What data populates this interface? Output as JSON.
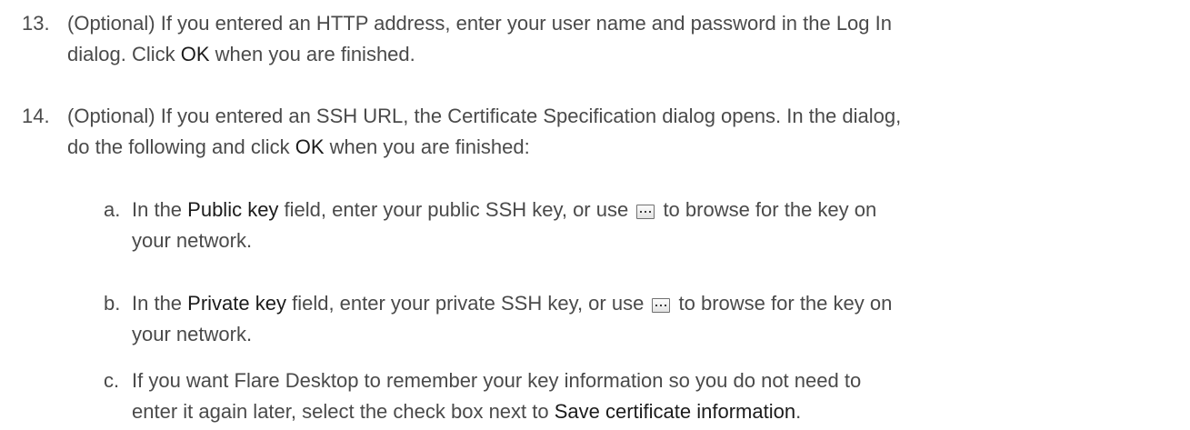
{
  "steps": [
    {
      "number": "13.",
      "line1": "(Optional) If you entered an HTTP address, enter your user name and password in the Log In",
      "line2_pre": "dialog. Click ",
      "ok": "OK",
      "line2_post": " when you are finished."
    },
    {
      "number": "14.",
      "line1": "(Optional) If you entered an SSH URL, the Certificate Specification dialog opens. In the dialog,",
      "line2_pre": "do the following and click ",
      "ok": "OK",
      "line2_post": " when you are finished:"
    }
  ],
  "substeps": [
    {
      "letter": "a.",
      "pre": "In the ",
      "field": "Public key",
      "mid": " field, enter your public SSH key, or use ",
      "post": " to browse for the key on",
      "line2": "your network.",
      "icon": "browse-ellipsis-icon"
    },
    {
      "letter": "b.",
      "pre": "In the ",
      "field": "Private key",
      "mid": " field, enter your private SSH key, or use ",
      "post": " to browse for the key on",
      "line2": "your network.",
      "icon": "browse-ellipsis-icon"
    },
    {
      "letter": "c.",
      "line1": "If you want Flare Desktop to remember your key information so you do not need to",
      "line2_pre": "enter it again later, select the check box next to ",
      "option": "Save certificate information",
      "line2_post": "."
    }
  ]
}
